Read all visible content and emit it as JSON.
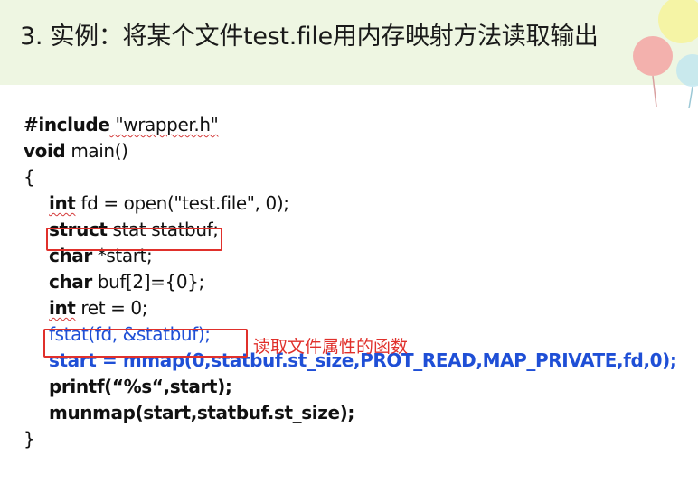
{
  "title": "3. 实例：将某个文件test.file用内存映射方法读取输出",
  "code": {
    "line1_kw": "#include",
    "line1_rest": " \"wrapper.h\"",
    "line2_kw": "void",
    "line2_rest": " main()",
    "line3": "{",
    "line4_kw": "int",
    "line4_rest": " fd = open(\"test.file\", 0);",
    "line5_kw": "struct",
    "line5_rest": " stat statbuf;",
    "line6_kw": "char",
    "line6_rest": " *start;",
    "line7_kw": "char",
    "line7_rest": " buf[2]={0};",
    "line8_kw": "int",
    "line8_rest": " ret = 0;",
    "line9": "fstat(fd, &statbuf);",
    "line10": "start = mmap(0,statbuf.st_size,PROT_READ,MAP_PRIVATE,fd,0);",
    "line11": "printf(“%s“,start);",
    "line12": "munmap(start,statbuf.st_size);",
    "line13": "}"
  },
  "annotation": "读取文件属性的函数",
  "colors": {
    "accent_blue": "#1f4fd6",
    "highlight_red": "#e0302b",
    "header_bg": "#eef6e2"
  }
}
